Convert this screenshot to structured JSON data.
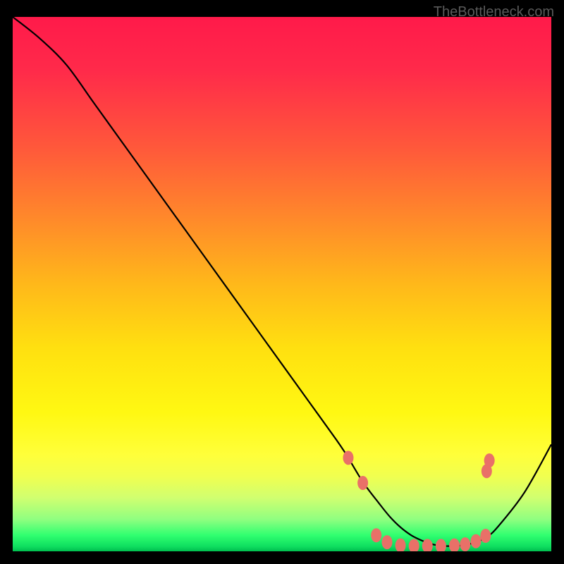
{
  "watermark": "TheBottleneck.com",
  "chart_data": {
    "type": "line",
    "title": "",
    "xlabel": "",
    "ylabel": "",
    "xlim": [
      0,
      100
    ],
    "ylim": [
      0,
      100
    ],
    "grid": false,
    "legend": false,
    "series": [
      {
        "name": "curve",
        "x": [
          0,
          5,
          10,
          15,
          20,
          25,
          30,
          35,
          40,
          45,
          50,
          55,
          60,
          62,
          65,
          68,
          70,
          72,
          74,
          76,
          78,
          80,
          82,
          84,
          86,
          88,
          90,
          95,
          100
        ],
        "y": [
          100,
          96,
          91,
          84,
          77,
          70,
          63,
          56,
          49,
          42,
          35,
          28,
          21,
          18,
          13,
          9,
          6.5,
          4.5,
          3,
          2,
          1.3,
          1,
          1,
          1.2,
          1.7,
          2.7,
          4.5,
          11,
          20
        ]
      }
    ],
    "markers": [
      {
        "x": 62.3,
        "y": 17.5
      },
      {
        "x": 65.0,
        "y": 12.8
      },
      {
        "x": 67.5,
        "y": 3.0
      },
      {
        "x": 69.5,
        "y": 1.7
      },
      {
        "x": 72.0,
        "y": 1.1
      },
      {
        "x": 74.5,
        "y": 1.0
      },
      {
        "x": 77.0,
        "y": 1.0
      },
      {
        "x": 79.5,
        "y": 1.0
      },
      {
        "x": 82.0,
        "y": 1.1
      },
      {
        "x": 84.0,
        "y": 1.3
      },
      {
        "x": 86.0,
        "y": 1.9
      },
      {
        "x": 87.8,
        "y": 2.9
      },
      {
        "x": 88.0,
        "y": 15.0
      },
      {
        "x": 88.5,
        "y": 17.0
      }
    ],
    "background_gradient": {
      "orientation": "vertical",
      "stops": [
        {
          "pos": 0.0,
          "color": "#ff1a4a"
        },
        {
          "pos": 0.5,
          "color": "#ffb81a"
        },
        {
          "pos": 0.82,
          "color": "#ffff3a"
        },
        {
          "pos": 1.0,
          "color": "#00c050"
        }
      ]
    }
  }
}
